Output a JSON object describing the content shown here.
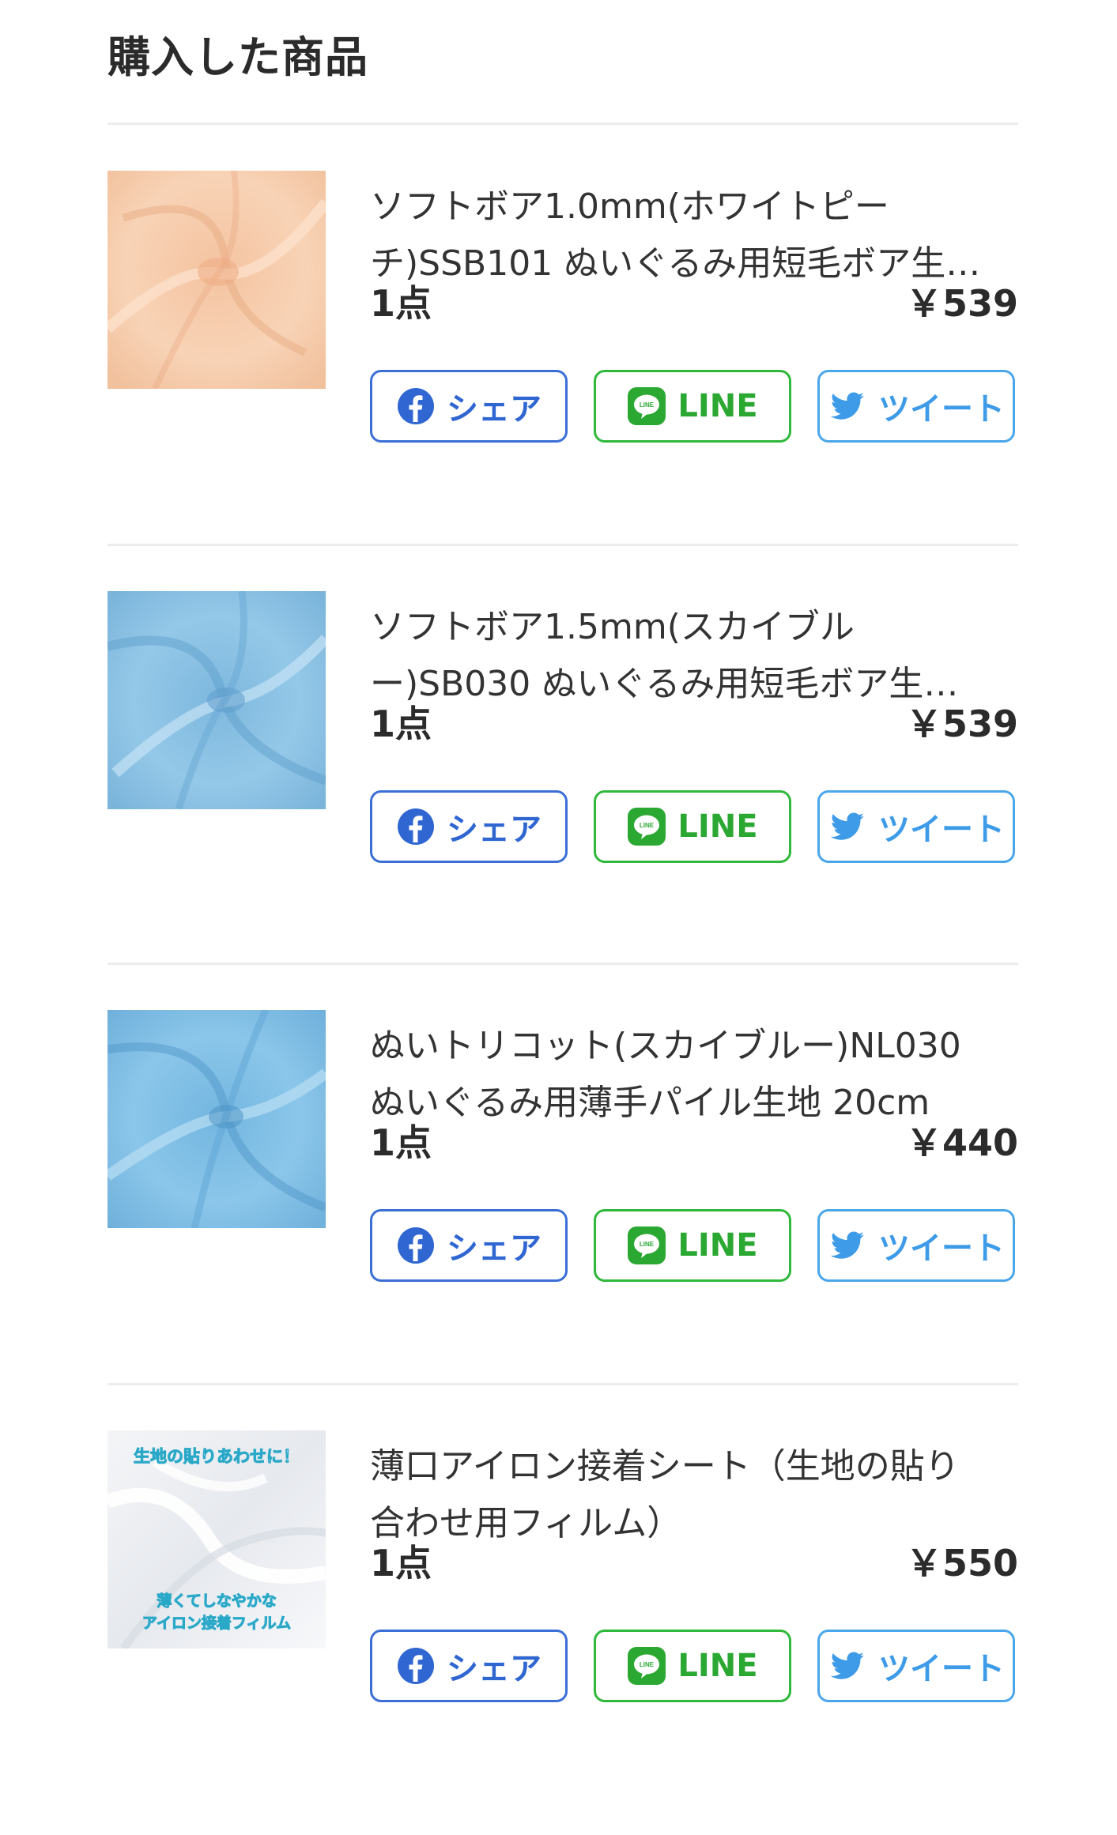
{
  "page": {
    "title": "購入した商品"
  },
  "share_buttons": {
    "facebook_label": "シェア",
    "line_label": "LINE",
    "line_icon_text": "LINE",
    "twitter_label": "ツイート"
  },
  "thumbnail_text": {
    "top": "生地の貼りあわせに！",
    "bottom_1": "薄くてしなやかな",
    "bottom_2": "アイロン接着フィルム"
  },
  "items": [
    {
      "name": "ソフトボア1.0mm(ホワイトピー\nチ)SSB101 ぬいぐるみ用短毛ボア生…",
      "quantity": "1点",
      "price": "￥539",
      "image_icon": "fabric-white-peach",
      "image_color": "#f6cfb0"
    },
    {
      "name": "ソフトボア1.5mm(スカイブル\nー)SB030 ぬいぐるみ用短毛ボア生…",
      "quantity": "1点",
      "price": "￥539",
      "image_icon": "fabric-sky-blue",
      "image_color": "#8fc4e6"
    },
    {
      "name": "ぬいトリコット(スカイブルー)NL030\nぬいぐるみ用薄手パイル生地 20cm",
      "quantity": "1点",
      "price": "￥440",
      "image_icon": "fabric-sky-blue-tricot",
      "image_color": "#84c2e8"
    },
    {
      "name": "薄口アイロン接着シート（生地の貼り\n合わせ用フィルム）",
      "quantity": "1点",
      "price": "￥550",
      "image_icon": "iron-adhesive-film",
      "image_color": "#eef0f3"
    }
  ],
  "colors": {
    "facebook": "#2f66d1",
    "line": "#2aa832",
    "twitter": "#3e9be8",
    "divider": "#ececec"
  }
}
